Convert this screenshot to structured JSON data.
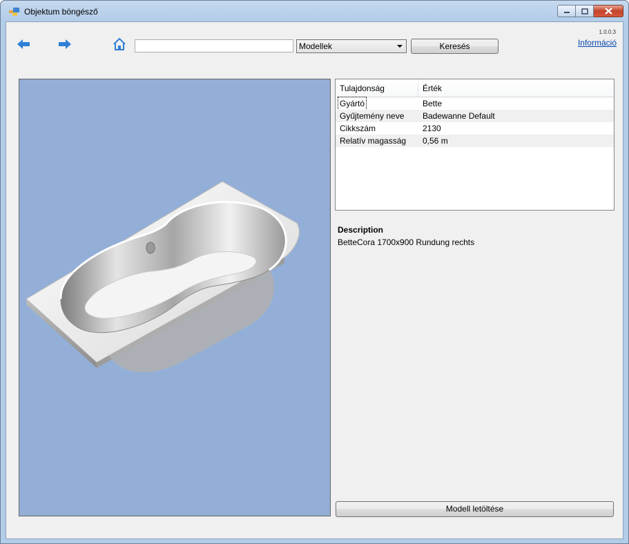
{
  "window": {
    "title": "Objektum böngésző",
    "icons": {
      "app": "app-window-icon",
      "minimize": "minimize-icon",
      "maximize": "maximize-icon",
      "close": "close-icon"
    }
  },
  "toolbar": {
    "back_icon": "arrow-left-icon",
    "forward_icon": "arrow-right-icon",
    "home_icon": "home-icon",
    "search_value": "",
    "category_selected": "Modellek",
    "search_label": "Keresés",
    "version": "1.0.0.3",
    "info_link": "Információ"
  },
  "properties": {
    "columns": [
      "Tulajdonság",
      "Érték"
    ],
    "rows": [
      {
        "key": "Gyártó",
        "value": "Bette"
      },
      {
        "key": "Gyűjtemény neve",
        "value": "Badewanne Default"
      },
      {
        "key": "Cikkszám",
        "value": "2130"
      },
      {
        "key": "Relatív magasság",
        "value": "0,56 m"
      }
    ]
  },
  "description": {
    "title": "Description",
    "text": "BetteCora 1700x900 Rundung rechts"
  },
  "download_label": "Modell letöltése",
  "colors": {
    "viewport_bg": "#93afd7",
    "nav_arrow": "#2f7fd6",
    "link": "#0645ad"
  }
}
